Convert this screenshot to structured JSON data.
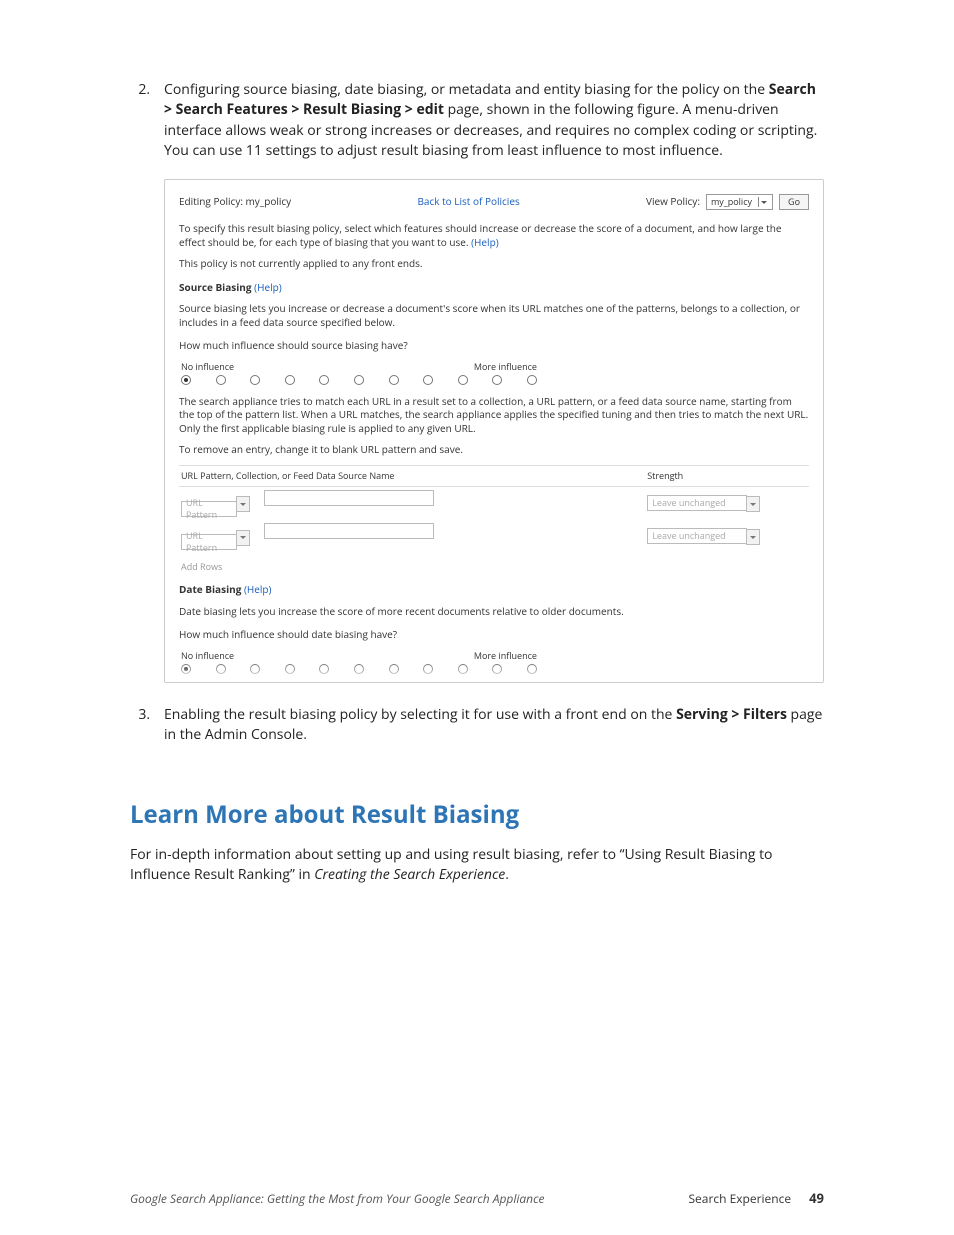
{
  "list": {
    "item2": {
      "num": "2.",
      "text_a": "Configuring source biasing, date biasing, or metadata and entity biasing for the policy on the ",
      "bold": "Search > Search Features > Result Biasing > edit",
      "text_b": " page, shown in the following figure. A menu-driven interface allows weak or strong increases or decreases, and requires no complex coding or scripting. You can use 11 settings to adjust result biasing from least influence to most influence."
    },
    "item3": {
      "num": "3.",
      "text_a": "Enabling the result biasing policy by selecting it for use with a front end on the ",
      "bold": "Serving > Filters",
      "text_b": " page in the Admin Console."
    }
  },
  "screenshot": {
    "editing_label": "Editing Policy: my_policy",
    "back_link": "Back to List of Policies",
    "view_label": "View Policy:",
    "view_value": "my_policy",
    "go": "Go",
    "intro_a": "To specify this result biasing policy, select which features should increase or decrease the score of a document, and how large the effect should be, for each type of biasing that you want to use. ",
    "help": "(Help)",
    "not_applied": "This policy is not currently applied to any front ends.",
    "source_label": "Source Biasing",
    "source_desc": "Source biasing lets you increase or decrease a document's score when its URL matches one of the patterns, belongs to a collection, or includes in a feed data source specified below.",
    "source_q": "How much influence should source biasing have?",
    "no_inf": "No influence",
    "more_inf": "More influence",
    "match_desc": "The search appliance tries to match each URL in a result set to a collection, a URL pattern, or a feed data source name, starting from the top of the pattern list. When a URL matches, the search appliance applies the specified tuning and then tries to match the next URL. Only the first applicable biasing rule is applied to any given URL.",
    "remove_desc": "To remove an entry, change it to blank URL pattern and save.",
    "col1": "URL Pattern, Collection, or Feed Data Source Name",
    "col2": "Strength",
    "placeholder": "URL Pattern",
    "strength_val": "Leave unchanged",
    "add_rows": "Add Rows",
    "date_label": "Date Biasing",
    "date_desc": "Date biasing lets you increase the score of more recent documents relative to older documents.",
    "date_q": "How much influence should date biasing have?"
  },
  "section_heading": "Learn More about Result Biasing",
  "learn_more": {
    "a": "For in-depth information about setting up and using result biasing, refer to “Using Result Biasing to Influence Result Ranking” in ",
    "i": "Creating the Search Experience",
    "b": "."
  },
  "footer": {
    "left": "Google Search Appliance: Getting the Most from Your Google Search Appliance",
    "right_label": "Search Experience",
    "page": "49"
  }
}
